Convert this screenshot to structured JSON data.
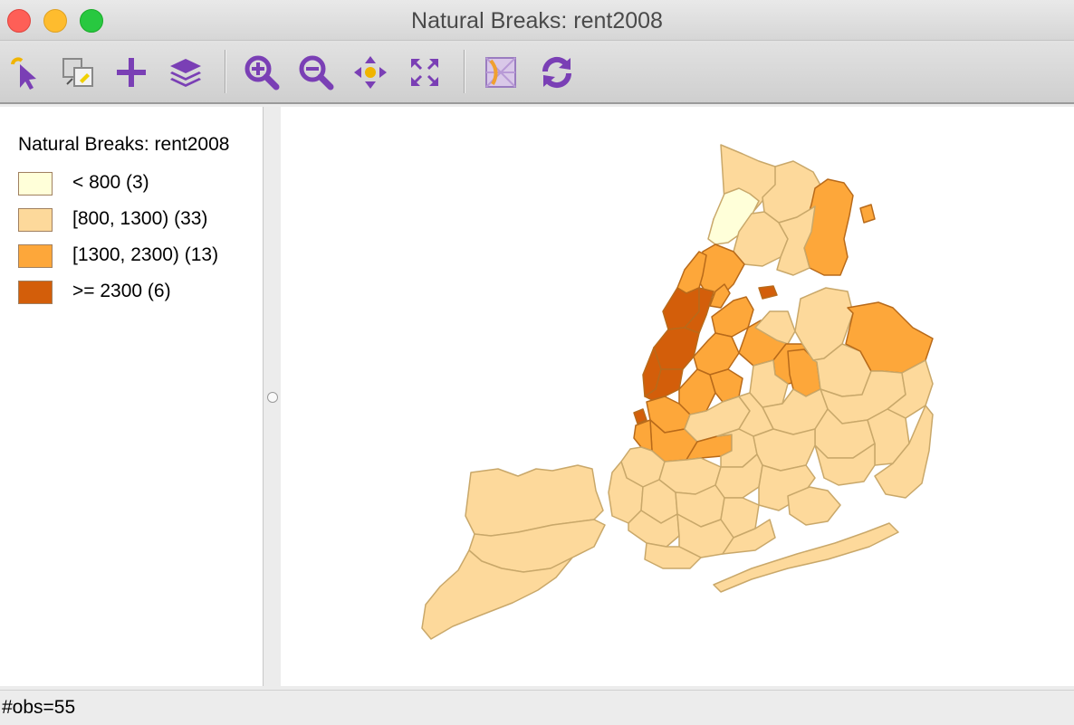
{
  "window": {
    "title": "Natural Breaks: rent2008"
  },
  "toolbar": {
    "buttons": [
      {
        "icon": "select-pointer-icon"
      },
      {
        "icon": "selection-shape-icon"
      },
      {
        "icon": "add-icon"
      },
      {
        "icon": "layers-icon"
      },
      {
        "icon": "zoom-in-icon"
      },
      {
        "icon": "zoom-out-icon"
      },
      {
        "icon": "pan-icon"
      },
      {
        "icon": "full-extent-icon"
      },
      {
        "icon": "basemap-icon"
      },
      {
        "icon": "refresh-icon"
      }
    ],
    "icon_color": "#7a3fb5"
  },
  "legend": {
    "title": "Natural Breaks: rent2008",
    "items": [
      {
        "label": "< 800 (3)",
        "color": "#ffffd9"
      },
      {
        "label": "[800, 1300) (33)",
        "color": "#fdd99b"
      },
      {
        "label": "[1300, 2300) (13)",
        "color": "#fda73a"
      },
      {
        "label": ">= 2300 (6)",
        "color": "#d35e0a"
      }
    ]
  },
  "map": {
    "variable": "rent2008",
    "classification": "Natural Breaks",
    "region": "New York City sub-boroughs",
    "outline_color": "#c9a86a"
  },
  "status": {
    "text": "#obs=55"
  }
}
